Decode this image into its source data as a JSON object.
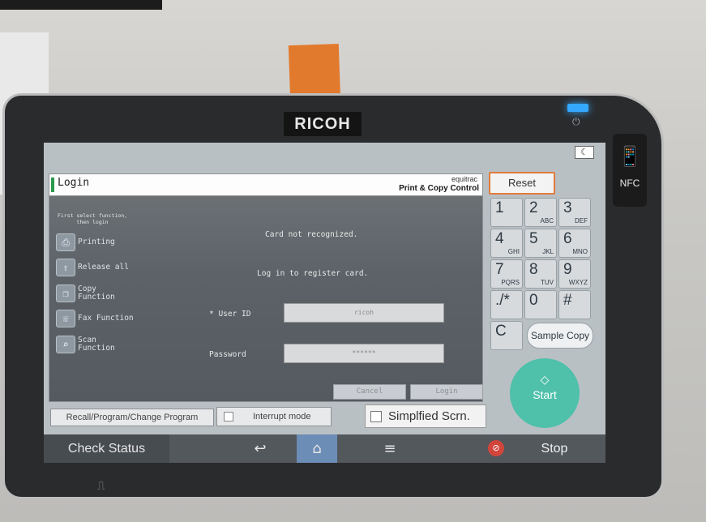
{
  "device": {
    "brand": "RICOH",
    "nfc_label": "NFC"
  },
  "panel": {
    "title": "Login",
    "vendor": "equitrac",
    "product": "Print & Copy Control",
    "hint_line1": "First select function,",
    "hint_line2": "then login",
    "functions": [
      {
        "label": "Printing",
        "icon": "printer-icon"
      },
      {
        "label": "Release all",
        "icon": "release-icon"
      },
      {
        "label_line1": "Copy",
        "label_line2": "Function",
        "icon": "copy-icon"
      },
      {
        "label": "Fax Function",
        "icon": "fax-icon"
      },
      {
        "label_line1": "Scan",
        "label_line2": "Function",
        "icon": "scan-icon"
      }
    ],
    "message1": "Card not recognized.",
    "message2": "Log in to register card.",
    "user_id_label": "* User ID",
    "user_id_value": "ricoh",
    "password_label": "Password",
    "password_value": "******",
    "cancel_label": "Cancel",
    "login_label": "Login"
  },
  "toolbar": {
    "recall_label": "Recall/Program/Change Program",
    "interrupt_label": "Interrupt mode",
    "simplified_label": "Simplfied Scrn."
  },
  "keypad": {
    "reset_label": "Reset",
    "keys": [
      {
        "digit": "1",
        "letters": ""
      },
      {
        "digit": "2",
        "letters": "ABC"
      },
      {
        "digit": "3",
        "letters": "DEF"
      },
      {
        "digit": "4",
        "letters": "GHI"
      },
      {
        "digit": "5",
        "letters": "JKL"
      },
      {
        "digit": "6",
        "letters": "MNO"
      },
      {
        "digit": "7",
        "letters": "PQRS"
      },
      {
        "digit": "8",
        "letters": "TUV"
      },
      {
        "digit": "9",
        "letters": "WXYZ"
      },
      {
        "digit": "./*",
        "letters": ""
      },
      {
        "digit": "0",
        "letters": ""
      },
      {
        "digit": "#",
        "letters": ""
      },
      {
        "digit": "C",
        "letters": ""
      }
    ],
    "sample_copy_label": "Sample Copy",
    "start_label": "Start"
  },
  "nav": {
    "check_status_label": "Check Status",
    "stop_label": "Stop"
  },
  "colors": {
    "start_button": "#4fc0aa",
    "reset_border": "#e07b3c",
    "home_highlight": "#6c8db6",
    "stop_icon": "#d2453b",
    "status_led": "#35a9ff"
  }
}
